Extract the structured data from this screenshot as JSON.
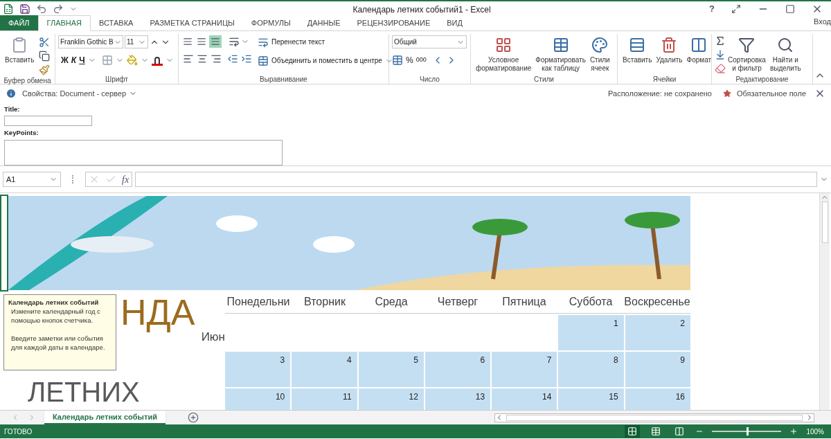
{
  "window": {
    "title": "Календарь летних событий1 - Excel",
    "help": "?",
    "account": "Вход"
  },
  "tabs": [
    {
      "label": "ФАЙЛ",
      "kind": "file",
      "selected": false
    },
    {
      "label": "ГЛАВНАЯ",
      "kind": "tab",
      "selected": true
    },
    {
      "label": "ВСТАВКА",
      "kind": "tab",
      "selected": false
    },
    {
      "label": "РАЗМЕТКА СТРАНИЦЫ",
      "kind": "tab",
      "selected": false
    },
    {
      "label": "ФОРМУЛЫ",
      "kind": "tab",
      "selected": false
    },
    {
      "label": "ДАННЫЕ",
      "kind": "tab",
      "selected": false
    },
    {
      "label": "РЕЦЕНЗИРОВАНИЕ",
      "kind": "tab",
      "selected": false
    },
    {
      "label": "ВИД",
      "kind": "tab",
      "selected": false
    }
  ],
  "ribbon": {
    "clipboard": {
      "paste": "Вставить",
      "label": "Буфер обмена"
    },
    "font": {
      "name": "Franklin Gothic B",
      "size": "11",
      "bold": "Ж",
      "italic": "К",
      "underline": "Ч",
      "label": "Шрифт"
    },
    "alignment": {
      "vertical": [
        {
          "selected": false
        },
        {
          "selected": false
        },
        {
          "selected": true
        }
      ],
      "wrap": "Перенести текст",
      "merge": "Объединить и поместить в центре",
      "label": "Выравнивание"
    },
    "number": {
      "format": "Общий",
      "percent": "%",
      "thousands": "000",
      "label": "Число"
    },
    "styles": {
      "buttons": [
        "Условное\nформатирование",
        "Форматировать\nкак таблицу",
        "Стили\nячеек"
      ],
      "label": "Стили"
    },
    "cells": {
      "buttons": [
        "Вставить",
        "Удалить",
        "Формат"
      ],
      "label": "Ячейки"
    },
    "editing": {
      "buttons": [
        "Сортировка\nи фильтр",
        "Найти и\nвыделить"
      ],
      "label": "Редактирование"
    }
  },
  "info_bar": {
    "text": "Свойства: Document - сервер",
    "location": "Расположение: не сохранено",
    "required": "Обязательное поле"
  },
  "properties": [
    {
      "label": "Title:",
      "kind": "line"
    },
    {
      "label": "KeyPoints:",
      "kind": "area"
    }
  ],
  "formula_bar": {
    "name_box": "A1",
    "fx": "fx"
  },
  "sheet": {
    "title_top": "НДА",
    "month": "Июн",
    "title_bottom": "ЛЕТНИХ",
    "days": [
      "Понедельни",
      "Вторник",
      "Среда",
      "Четверг",
      "Пятница",
      "Суббота",
      "Воскресенье"
    ],
    "weeks": [
      [
        {
          "kind": "blank"
        },
        {
          "kind": "blank"
        },
        {
          "kind": "blank"
        },
        {
          "kind": "blank"
        },
        {
          "kind": "blank"
        },
        {
          "kind": "date",
          "day": "1"
        },
        {
          "kind": "date",
          "day": "2"
        }
      ],
      [
        {
          "kind": "date",
          "day": "3"
        },
        {
          "kind": "date",
          "day": "4"
        },
        {
          "kind": "date",
          "day": "5"
        },
        {
          "kind": "date",
          "day": "6"
        },
        {
          "kind": "date",
          "day": "7"
        },
        {
          "kind": "date",
          "day": "8"
        },
        {
          "kind": "date",
          "day": "9"
        }
      ],
      [
        {
          "kind": "date",
          "day": "10"
        },
        {
          "kind": "date",
          "day": "11"
        },
        {
          "kind": "date",
          "day": "12"
        },
        {
          "kind": "date",
          "day": "13"
        },
        {
          "kind": "date",
          "day": "14"
        },
        {
          "kind": "date",
          "day": "15"
        },
        {
          "kind": "date",
          "day": "16"
        }
      ]
    ]
  },
  "tooltip": {
    "title": "Календарь летних событий",
    "lines": [
      "Измените календарный год с помощью кнопок счетчика.",
      "Введите заметки или события для каждой даты в календаре."
    ]
  },
  "sheet_tabs": [
    {
      "label": "Календарь летних событий",
      "selected": true
    }
  ],
  "status": {
    "text": "ГОТОВО",
    "views": [
      {
        "selected": true
      },
      {
        "selected": false
      },
      {
        "selected": false
      }
    ],
    "zoom_slider": {
      "level": 0.5
    },
    "zoom": "100%"
  }
}
